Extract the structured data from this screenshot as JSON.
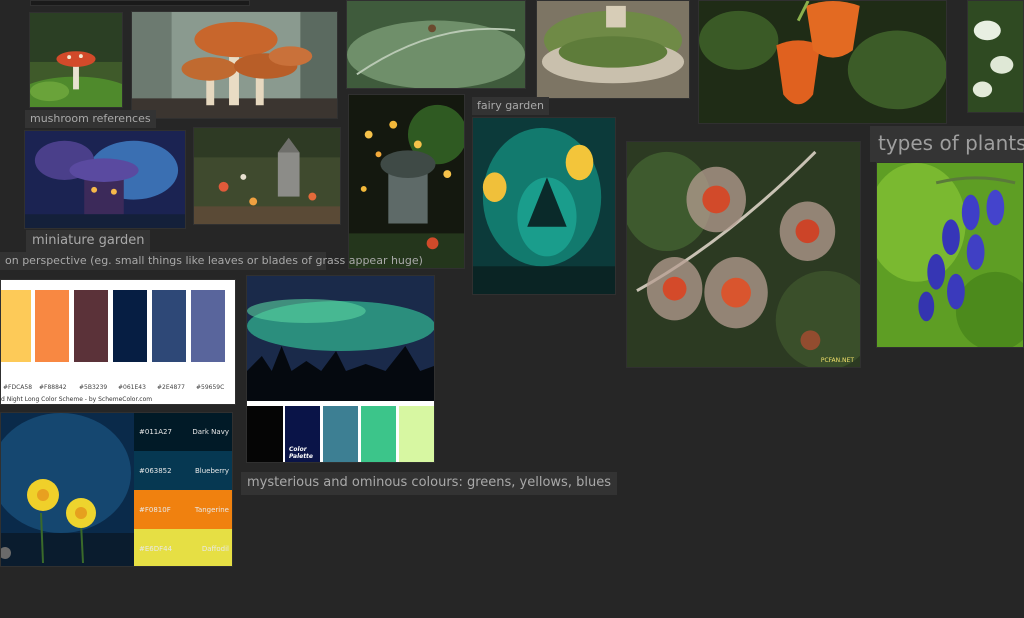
{
  "labels": {
    "mushroom_references": "mushroom references",
    "fairy_garden": "fairy garden",
    "types_of_plants": "types of plants",
    "miniature_garden": "miniature garden",
    "perspective_note": "on perspective (eg. small things like leaves or blades of grass appear huge)",
    "colours_note": "mysterious and ominous colours: greens, yellows, blues"
  },
  "palette_night": {
    "codes": [
      "#FDCA58",
      "#F88842",
      "#5B3239",
      "#061E43",
      "#2E4877",
      "#59659C"
    ],
    "caption": "d Night Long Color Scheme - by SchemeColor.com"
  },
  "palette_aurora": {
    "tag": "Color Palette"
  },
  "palette_daffodil": {
    "rows": [
      {
        "code": "#011A27",
        "name": "Dark Navy",
        "color": "#011A27"
      },
      {
        "code": "#063852",
        "name": "Blueberry",
        "color": "#063852"
      },
      {
        "code": "#F0810F",
        "name": "Tangerine",
        "color": "#F0810F"
      },
      {
        "code": "#E6DF44",
        "name": "Daffodil",
        "color": "#E6DF44"
      }
    ]
  },
  "watermark": "PCFAN.NET",
  "colors": {
    "background": "#262626",
    "label_bg": "#333333",
    "label_text": "#a9a9a9"
  }
}
